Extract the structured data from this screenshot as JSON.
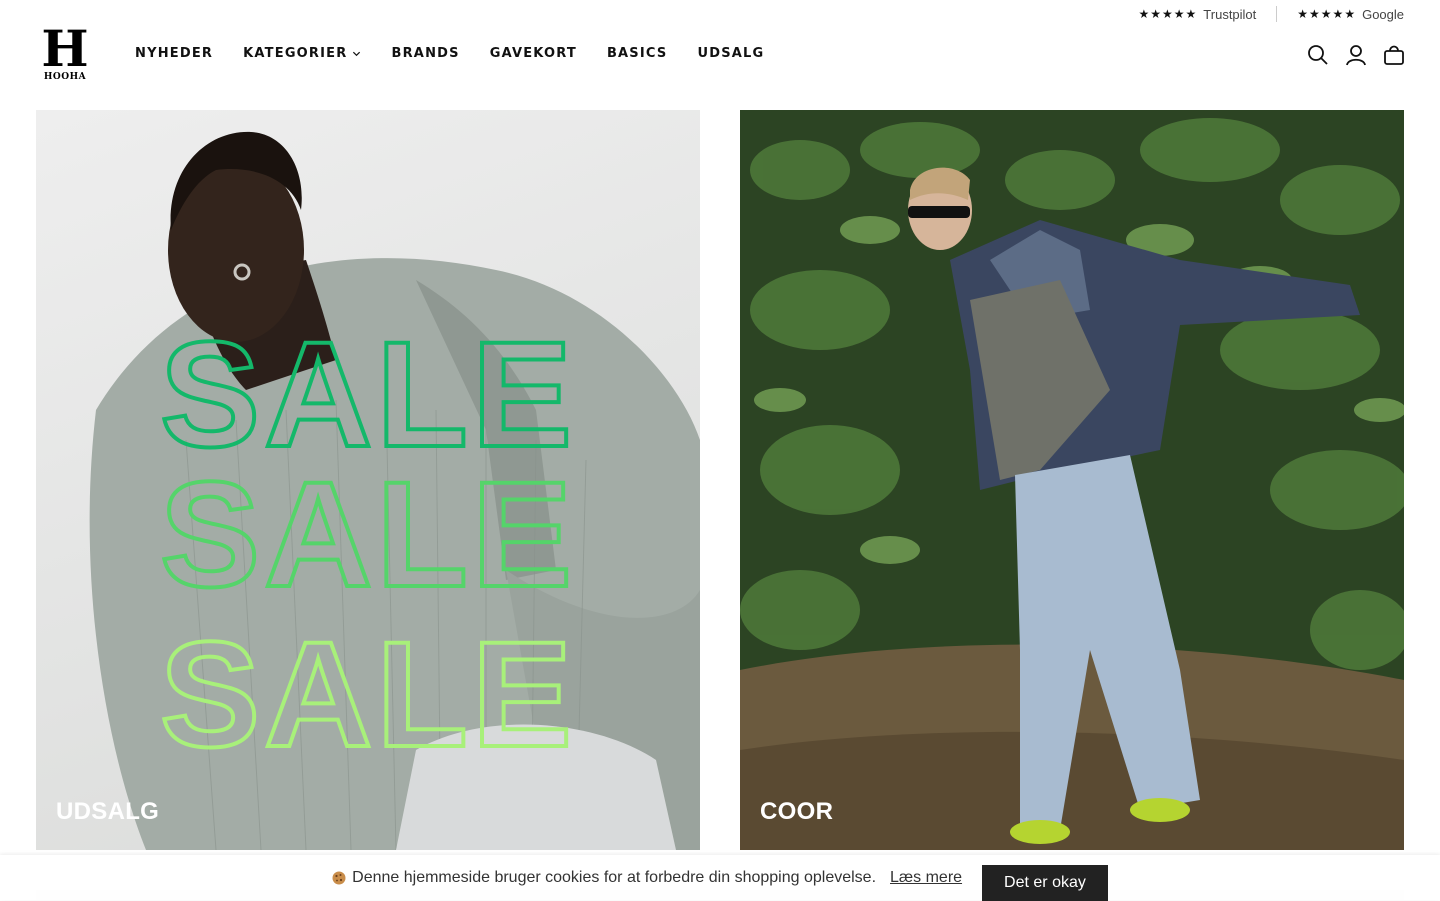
{
  "ratings": [
    {
      "stars": "★★★★★",
      "label": "Trustpilot"
    },
    {
      "stars": "★★★★★",
      "label": "Google"
    }
  ],
  "logo": {
    "mark": "H",
    "text": "HOOHA"
  },
  "nav": {
    "items": [
      {
        "label": "NYHEDER"
      },
      {
        "label": "KATEGORIER",
        "has_dropdown": true
      },
      {
        "label": "BRANDS"
      },
      {
        "label": "GAVEKORT"
      },
      {
        "label": "BASICS"
      },
      {
        "label": "UDSALG"
      }
    ]
  },
  "header_icons": [
    "search-icon",
    "account-icon",
    "cart-icon"
  ],
  "tiles": [
    {
      "label": "UDSALG",
      "overlay_text": [
        "SALE",
        "SALE",
        "SALE"
      ],
      "overlay_colors": [
        "#14b86a",
        "#55d46a",
        "#a8f07a"
      ]
    },
    {
      "label": "COOR"
    }
  ],
  "cookie": {
    "icon": "cookie-icon",
    "text": "Denne hjemmeside bruger cookies for at forbedre din shopping oplevelse.",
    "link": "Læs mere",
    "button": "Det er okay"
  },
  "colors": {
    "accent": "#111111",
    "cookie_button": "#222222"
  }
}
